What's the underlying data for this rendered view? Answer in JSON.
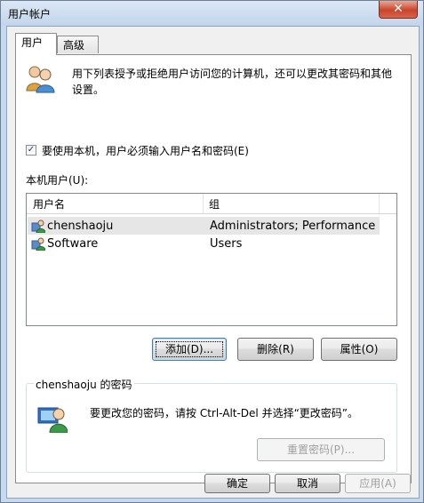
{
  "window": {
    "title": "用户帐户",
    "close_glyph": "✕"
  },
  "tabs": [
    {
      "label": "用户",
      "active": true
    },
    {
      "label": "高级",
      "active": false
    }
  ],
  "intro_text": "用下列表授予或拒绝用户访问您的计算机，还可以更改其密码和其他设置。",
  "require_login": {
    "label": "要使用本机，用户必须输入用户名和密码(E)",
    "checked": true,
    "check_glyph": "✓"
  },
  "local_users": {
    "label": "本机用户(U):",
    "columns": [
      "用户名",
      "组"
    ],
    "rows": [
      {
        "name": "chenshaoju",
        "group": "Administrators; Performance L...",
        "selected": true
      },
      {
        "name": "Software",
        "group": "Users",
        "selected": false
      }
    ]
  },
  "buttons": {
    "add": "添加(D)...",
    "remove": "删除(R)",
    "properties": "属性(O)"
  },
  "password_group": {
    "title": "chenshaoju 的密码",
    "text": "要更改您的密码，请按 Ctrl-Alt-Del 并选择“更改密码”。",
    "reset_button": "重置密码(P)..."
  },
  "footer": {
    "ok": "确定",
    "cancel": "取消",
    "apply": "应用(A)"
  }
}
